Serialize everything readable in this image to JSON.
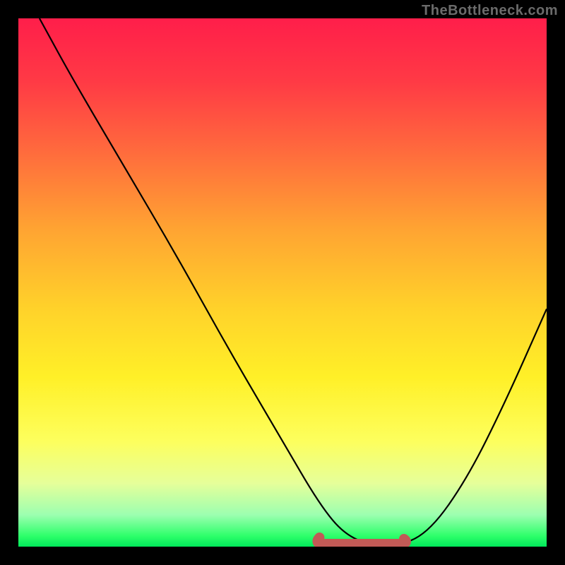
{
  "watermark": "TheBottleneck.com",
  "chart_data": {
    "type": "line",
    "title": "",
    "xlabel": "",
    "ylabel": "",
    "xlim": [
      0,
      100
    ],
    "ylim": [
      0,
      100
    ],
    "series": [
      {
        "name": "curve",
        "x": [
          4,
          10,
          20,
          30,
          40,
          50,
          57,
          62,
          68,
          72,
          78,
          85,
          92,
          100
        ],
        "y": [
          100,
          89,
          72,
          55,
          37,
          20,
          8,
          2,
          0,
          0,
          3,
          13,
          27,
          45
        ]
      }
    ],
    "highlight": {
      "name": "flat-segment",
      "x_range": [
        57,
        73
      ],
      "y": 0,
      "color": "#c15a56"
    }
  }
}
